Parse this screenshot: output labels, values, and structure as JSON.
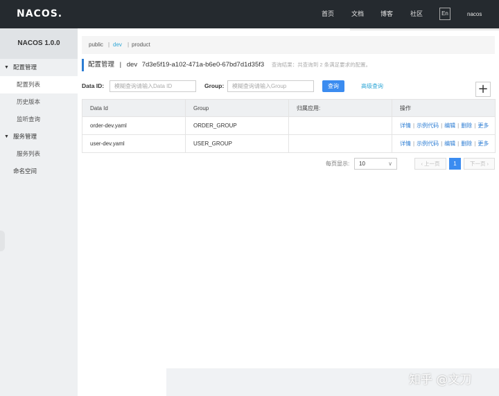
{
  "topbar": {
    "logo_text": "NACOS.",
    "nav": [
      "首页",
      "文档",
      "博客",
      "社区"
    ],
    "lang_button": "En",
    "user": "nacos"
  },
  "sidebar": {
    "title": "NACOS 1.0.0",
    "items": [
      {
        "label": "配置管理",
        "type": "group"
      },
      {
        "label": "配置列表",
        "type": "child",
        "active": true
      },
      {
        "label": "历史版本",
        "type": "child"
      },
      {
        "label": "监听查询",
        "type": "child"
      },
      {
        "label": "服务管理",
        "type": "group"
      },
      {
        "label": "服务列表",
        "type": "child"
      },
      {
        "label": "命名空间",
        "type": "top"
      }
    ]
  },
  "namespaces": {
    "items": [
      "public",
      "dev",
      "product"
    ],
    "separator": "|",
    "active": "dev"
  },
  "header": {
    "title": "配置管理",
    "separator": "|",
    "namespace": "dev",
    "namespace_id": "7d3e5f19-a102-471a-b6e0-67bd7d1d35f3",
    "hint": "查询结果：共查询到 2 条满足要求的配置。"
  },
  "search": {
    "data_id_label": "Data ID:",
    "data_id_placeholder": "模糊查询请输入Data ID",
    "group_label": "Group:",
    "group_placeholder": "模糊查询请输入Group",
    "query_button": "查询",
    "advanced_link": "高级查询",
    "add_button": "+"
  },
  "table": {
    "columns": [
      "Data Id",
      "Group",
      "归属应用:",
      "操作"
    ],
    "rows": [
      {
        "data_id": "order-dev.yaml",
        "group": "ORDER_GROUP",
        "app": ""
      },
      {
        "data_id": "user-dev.yaml",
        "group": "USER_GROUP",
        "app": ""
      }
    ],
    "operations": [
      "详情",
      "示例代码",
      "编辑",
      "删除",
      "更多"
    ],
    "op_separator": "|"
  },
  "pagination": {
    "page_size_label": "每页显示:",
    "page_size": "10",
    "prev": "上一页",
    "current_page": "1",
    "next": "下一页"
  },
  "watermark": "知乎 @文刀"
}
